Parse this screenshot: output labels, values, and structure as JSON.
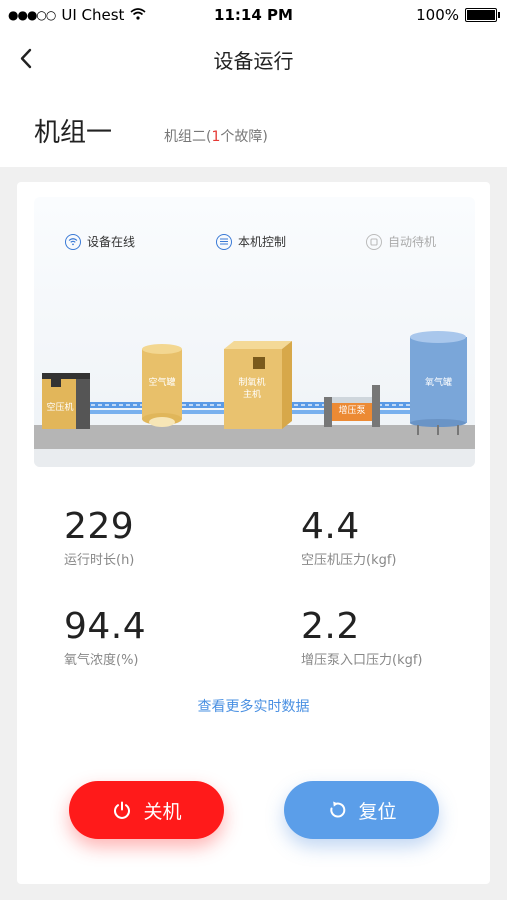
{
  "status_bar": {
    "carrier": "UI Chest",
    "time": "11:14 PM",
    "battery": "100%"
  },
  "nav": {
    "title": "设备运行"
  },
  "units": {
    "unit1": "机组一",
    "unit2_prefix": "机组二(",
    "unit2_count": "1",
    "unit2_suffix": "个故障)"
  },
  "status_tags": [
    {
      "label": "设备在线",
      "icon": "wifi-icon",
      "active": true
    },
    {
      "label": "本机控制",
      "icon": "list-icon",
      "active": true
    },
    {
      "label": "自动待机",
      "icon": "standby-icon",
      "active": false
    }
  ],
  "equipment": {
    "compressor": "空压机",
    "air_tank": "空气罐",
    "oxygen_generator_line1": "制氧机",
    "oxygen_generator_line2": "主机",
    "booster": "增压泵",
    "oxygen_tank": "氧气罐"
  },
  "metrics": [
    {
      "value": "229",
      "label": "运行时长(h)"
    },
    {
      "value": "4.4",
      "label": "空压机压力(kgf)"
    },
    {
      "value": "94.4",
      "label": "氧气浓度(%)"
    },
    {
      "value": "2.2",
      "label": "增压泵入口压力(kgf)"
    }
  ],
  "more_link": "查看更多实时数据",
  "buttons": {
    "power_off": "关机",
    "reset": "复位"
  },
  "colors": {
    "accent_blue": "#4a90e2",
    "danger_red": "#ff1a1a",
    "reset_blue": "#5b9ee9",
    "equipment_yellow": "#e9bf62"
  }
}
